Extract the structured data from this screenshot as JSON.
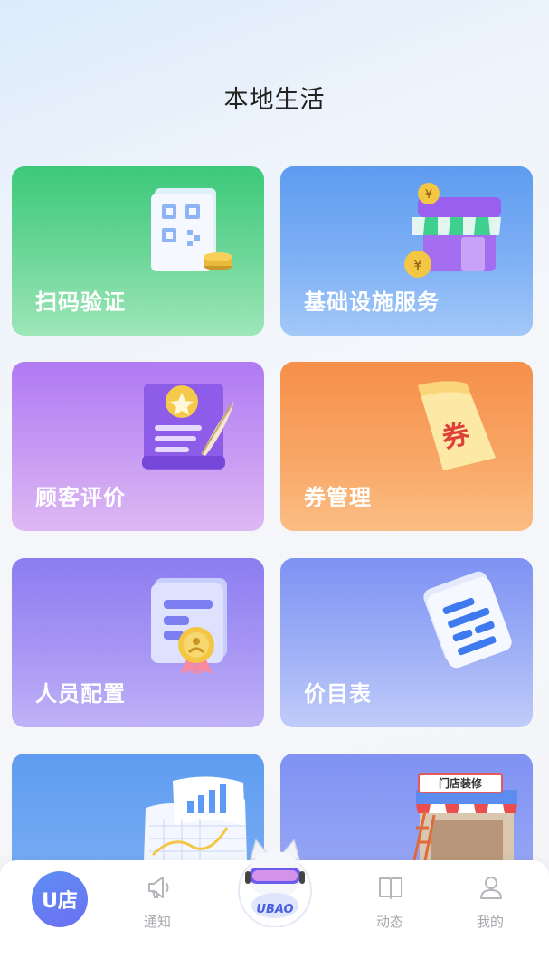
{
  "header": {
    "title": "本地生活"
  },
  "cards": [
    {
      "label": "扫码验证",
      "icon": "qr-scan-icon"
    },
    {
      "label": "基础设施服务",
      "icon": "store-icon"
    },
    {
      "label": "顾客评价",
      "icon": "review-certificate-icon"
    },
    {
      "label": "券管理",
      "icon": "coupon-icon"
    },
    {
      "label": "人员配置",
      "icon": "staff-badge-icon"
    },
    {
      "label": "价目表",
      "icon": "price-list-icon"
    },
    {
      "label": "",
      "icon": "chart-report-icon"
    },
    {
      "label": "",
      "icon": "shop-decoration-icon",
      "sign": "门店装修"
    }
  ],
  "tabbar": {
    "home": {
      "label": "U店",
      "icon": "u-store-logo"
    },
    "notify": {
      "label": "通知",
      "icon": "megaphone-icon"
    },
    "center": {
      "label": "UBAO",
      "icon": "mascot-icon"
    },
    "feed": {
      "label": "动态",
      "icon": "book-icon"
    },
    "mine": {
      "label": "我的",
      "icon": "user-icon"
    }
  }
}
